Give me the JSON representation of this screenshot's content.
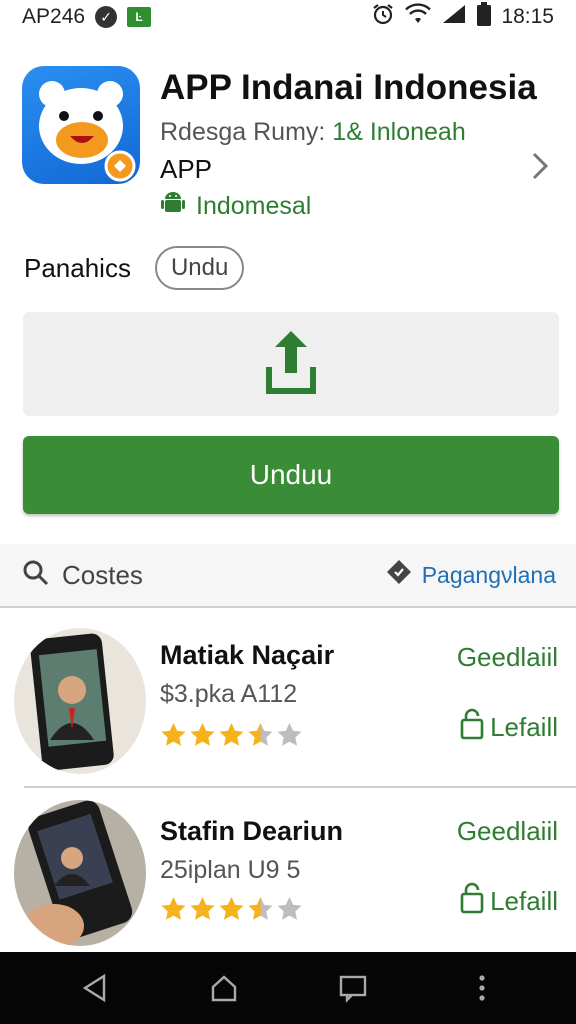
{
  "status_bar": {
    "carrier": "AP246",
    "time": "18:15",
    "icons": [
      "check-circle-icon",
      "green-notification-icon",
      "alarm-icon",
      "wifi-icon",
      "signal-icon",
      "battery-icon"
    ]
  },
  "app": {
    "title": "APP Indanai Indonesia",
    "subtitle_prefix": "Rdesga Rumy: ",
    "subtitle_highlight": "1& Inloneah",
    "subtitle_line2": "APP",
    "developer": "Indomesal"
  },
  "category": {
    "label": "Panahics",
    "chip": "Undu"
  },
  "download_button": "Unduu",
  "search": {
    "label": "Costes",
    "link": "Pagangνlana"
  },
  "items": [
    {
      "title": "Matiak Naçair",
      "meta": "$3.pka A112",
      "rating": 3.5,
      "action": "Geedlaiil",
      "button": "Lefaill"
    },
    {
      "title": "Stafin Deariun",
      "meta": "25iplan U9 5",
      "rating": 3.5,
      "action": "Geedlaiil",
      "button": "Lefaill"
    }
  ],
  "colors": {
    "accent_green": "#3a8c36",
    "text_green": "#2e7d32",
    "link_blue": "#1f6fb5",
    "star": "#f5b21b"
  }
}
